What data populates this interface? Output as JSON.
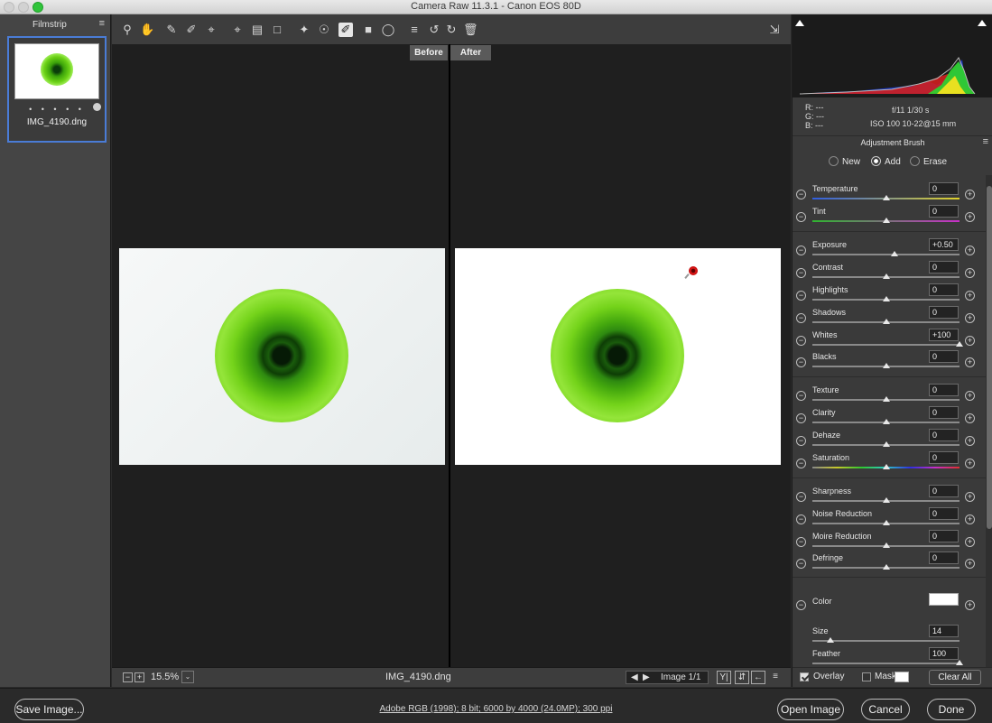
{
  "window": {
    "title": "Camera Raw 11.3.1  -  Canon EOS 80D"
  },
  "filmstrip": {
    "label": "Filmstrip",
    "thumb_dots": "• • • • •",
    "file_name": "IMG_4190.dng"
  },
  "toolbar": {
    "tools": [
      "zoom-icon",
      "hand-icon",
      "white-balance-icon",
      "color-sampler-icon",
      "targeted-adjustment-icon",
      "crop-icon",
      "straighten-icon",
      "transform-icon",
      "spot-removal-icon",
      "red-eye-icon",
      "adjustment-brush-icon",
      "graduated-filter-icon",
      "radial-filter-icon",
      "preferences-icon",
      "rotate-ccw-icon",
      "rotate-cw-icon",
      "trash-icon"
    ],
    "active_tool": "adjustment-brush-icon"
  },
  "view": {
    "before_label": "Before",
    "after_label": "After"
  },
  "statusbar": {
    "zoom": "15.5%",
    "file_name": "IMG_4190.dng",
    "image_counter": "Image 1/1"
  },
  "histogram": {
    "r": "R:   ---",
    "g": "G:   ---",
    "b": "B:   ---",
    "exif_line1": "f/11   1/30 s",
    "exif_line2": "ISO 100   10-22@15 mm"
  },
  "panel": {
    "title": "Adjustment Brush",
    "modes": [
      {
        "label": "New",
        "selected": false
      },
      {
        "label": "Add",
        "selected": true
      },
      {
        "label": "Erase",
        "selected": false
      }
    ],
    "sliders": [
      {
        "label": "Temperature",
        "value": "0",
        "pos": 0.5,
        "track": "temp"
      },
      {
        "label": "Tint",
        "value": "0",
        "pos": 0.5,
        "track": "tint"
      },
      {
        "label": "Exposure",
        "value": "+0.50",
        "pos": 0.56,
        "track": "plain"
      },
      {
        "label": "Contrast",
        "value": "0",
        "pos": 0.5,
        "track": "plain"
      },
      {
        "label": "Highlights",
        "value": "0",
        "pos": 0.5,
        "track": "plain"
      },
      {
        "label": "Shadows",
        "value": "0",
        "pos": 0.5,
        "track": "plain"
      },
      {
        "label": "Whites",
        "value": "+100",
        "pos": 1.0,
        "track": "plain"
      },
      {
        "label": "Blacks",
        "value": "0",
        "pos": 0.5,
        "track": "plain"
      },
      {
        "label": "Texture",
        "value": "0",
        "pos": 0.5,
        "track": "plain"
      },
      {
        "label": "Clarity",
        "value": "0",
        "pos": 0.5,
        "track": "plain"
      },
      {
        "label": "Dehaze",
        "value": "0",
        "pos": 0.5,
        "track": "plain"
      },
      {
        "label": "Saturation",
        "value": "0",
        "pos": 0.5,
        "track": "sat"
      },
      {
        "label": "Sharpness",
        "value": "0",
        "pos": 0.5,
        "track": "plain"
      },
      {
        "label": "Noise Reduction",
        "value": "0",
        "pos": 0.5,
        "track": "plain"
      },
      {
        "label": "Moire Reduction",
        "value": "0",
        "pos": 0.5,
        "track": "plain"
      },
      {
        "label": "Defringe",
        "value": "0",
        "pos": 0.5,
        "track": "plain"
      }
    ],
    "color_label": "Color",
    "size_label": "Size",
    "size_value": "14",
    "size_pos": 0.12,
    "feather_label": "Feather",
    "feather_value": "100",
    "feather_pos": 1.0,
    "overlay_label": "Overlay",
    "overlay_checked": true,
    "mask_label": "Mask",
    "mask_checked": false,
    "clear_all": "Clear All"
  },
  "bottom": {
    "save_button": "Save Image...",
    "workflow_link": "Adobe RGB (1998); 8 bit; 6000 by 4000 (24.0MP); 300 ppi",
    "open_button": "Open Image",
    "cancel_button": "Cancel",
    "done_button": "Done"
  }
}
